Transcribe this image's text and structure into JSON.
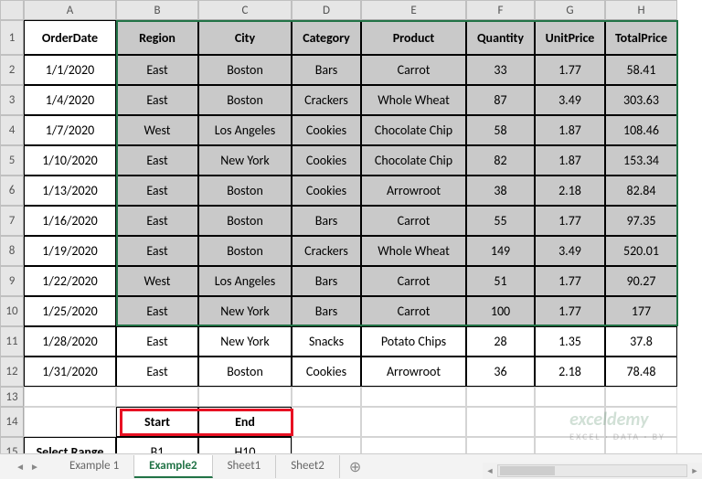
{
  "columns": [
    "A",
    "B",
    "C",
    "D",
    "E",
    "F",
    "G",
    "H"
  ],
  "rows": [
    "1",
    "2",
    "3",
    "4",
    "5",
    "6",
    "7",
    "8",
    "9",
    "10",
    "11",
    "12",
    "13",
    "14",
    "15"
  ],
  "headers": [
    "OrderDate",
    "Region",
    "City",
    "Category",
    "Product",
    "Quantity",
    "UnitPrice",
    "TotalPrice"
  ],
  "data": [
    [
      "1/1/2020",
      "East",
      "Boston",
      "Bars",
      "Carrot",
      "33",
      "1.77",
      "58.41"
    ],
    [
      "1/4/2020",
      "East",
      "Boston",
      "Crackers",
      "Whole Wheat",
      "87",
      "3.49",
      "303.63"
    ],
    [
      "1/7/2020",
      "West",
      "Los Angeles",
      "Cookies",
      "Chocolate Chip",
      "58",
      "1.87",
      "108.46"
    ],
    [
      "1/10/2020",
      "East",
      "New York",
      "Cookies",
      "Chocolate Chip",
      "82",
      "1.87",
      "153.34"
    ],
    [
      "1/13/2020",
      "East",
      "Boston",
      "Cookies",
      "Arrowroot",
      "38",
      "2.18",
      "82.84"
    ],
    [
      "1/16/2020",
      "East",
      "Boston",
      "Bars",
      "Carrot",
      "55",
      "1.77",
      "97.35"
    ],
    [
      "1/19/2020",
      "East",
      "Boston",
      "Crackers",
      "Whole Wheat",
      "149",
      "3.49",
      "520.01"
    ],
    [
      "1/22/2020",
      "West",
      "Los Angeles",
      "Bars",
      "Carrot",
      "51",
      "1.77",
      "90.27"
    ],
    [
      "1/25/2020",
      "East",
      "New York",
      "Bars",
      "Carrot",
      "100",
      "1.77",
      "177"
    ],
    [
      "1/28/2020",
      "East",
      "New York",
      "Snacks",
      "Potato Chips",
      "28",
      "1.35",
      "37.8"
    ],
    [
      "1/31/2020",
      "East",
      "Boston",
      "Cookies",
      "Arrowroot",
      "36",
      "2.18",
      "78.48"
    ]
  ],
  "range_section": {
    "start_label": "Start",
    "end_label": "End",
    "select_label": "Select Range",
    "start_value": "B1",
    "end_value": "H10"
  },
  "tabs": [
    "Example 1",
    "Example2",
    "Sheet1",
    "Sheet2"
  ],
  "active_tab": 1,
  "watermark": {
    "main": "exceldemy",
    "sub": "EXCEL · DATA · BY"
  }
}
